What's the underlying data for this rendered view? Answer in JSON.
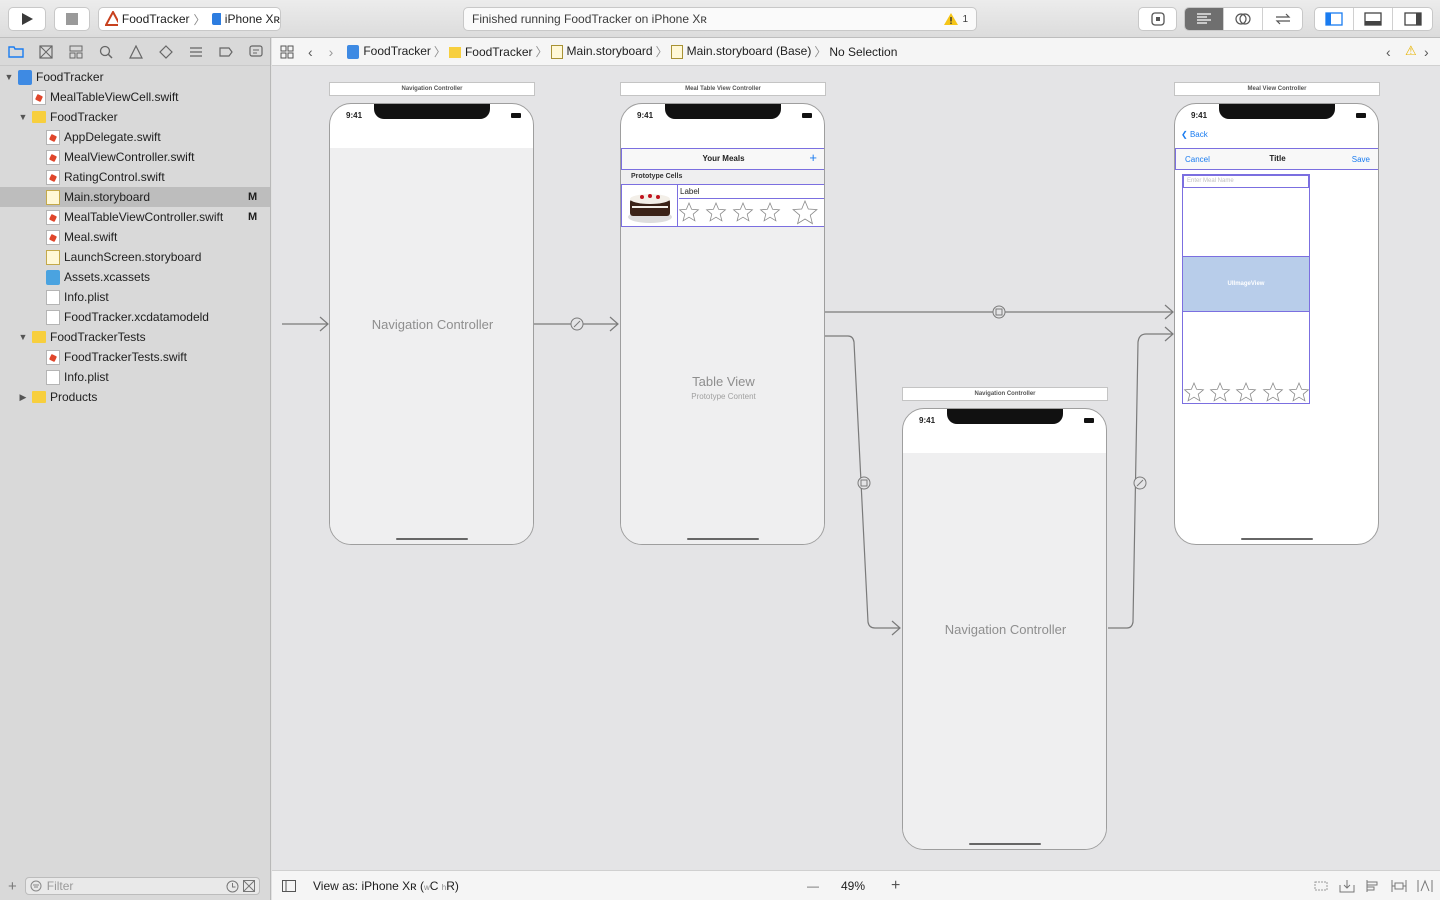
{
  "toolbar": {
    "scheme": {
      "project": "FoodTracker",
      "device": "iPhone Xʀ"
    },
    "activity": {
      "status": "Finished running FoodTracker on iPhone Xʀ",
      "warning_count": "1"
    }
  },
  "navigator": {
    "filter_placeholder": "Filter",
    "items": [
      {
        "label": "FoodTracker",
        "kind": "project",
        "indent": 0,
        "disclosure": "open"
      },
      {
        "label": "MealTableViewCell.swift",
        "kind": "swift",
        "indent": 1
      },
      {
        "label": "FoodTracker",
        "kind": "folder",
        "indent": 1,
        "disclosure": "open"
      },
      {
        "label": "AppDelegate.swift",
        "kind": "swift",
        "indent": 2
      },
      {
        "label": "MealViewController.swift",
        "kind": "swift",
        "indent": 2
      },
      {
        "label": "RatingControl.swift",
        "kind": "swift",
        "indent": 2
      },
      {
        "label": "Main.storyboard",
        "kind": "storyboard",
        "indent": 2,
        "badge": "M",
        "selected": true
      },
      {
        "label": "MealTableViewController.swift",
        "kind": "swift",
        "indent": 2,
        "badge": "M"
      },
      {
        "label": "Meal.swift",
        "kind": "swift",
        "indent": 2
      },
      {
        "label": "LaunchScreen.storyboard",
        "kind": "storyboard",
        "indent": 2
      },
      {
        "label": "Assets.xcassets",
        "kind": "assets",
        "indent": 2
      },
      {
        "label": "Info.plist",
        "kind": "plist",
        "indent": 2
      },
      {
        "label": "FoodTracker.xcdatamodeld",
        "kind": "plist",
        "indent": 2
      },
      {
        "label": "FoodTrackerTests",
        "kind": "folder",
        "indent": 1,
        "disclosure": "open"
      },
      {
        "label": "FoodTrackerTests.swift",
        "kind": "swift",
        "indent": 2
      },
      {
        "label": "Info.plist",
        "kind": "plist",
        "indent": 2
      },
      {
        "label": "Products",
        "kind": "folder",
        "indent": 1,
        "disclosure": "closed"
      }
    ]
  },
  "jumpbar": {
    "crumbs": [
      "FoodTracker",
      "FoodTracker",
      "Main.storyboard",
      "Main.storyboard (Base)",
      "No Selection"
    ],
    "warning": "⚠"
  },
  "canvas": {
    "scene1": {
      "title": "Navigation Controller",
      "time": "9:41",
      "label": "Navigation Controller"
    },
    "scene2": {
      "title": "Meal Table View Controller",
      "time": "9:41",
      "nav_title": "Your Meals",
      "add": "+",
      "section": "Prototype Cells",
      "cell_label": "Label",
      "table_title": "Table View",
      "table_sub": "Prototype Content"
    },
    "scene3": {
      "title": "Navigation Controller",
      "time": "9:41",
      "label": "Navigation Controller"
    },
    "scene4": {
      "title": "Meal View Controller",
      "time": "9:41",
      "back": "Back",
      "cancel": "Cancel",
      "nav_title": "Title",
      "save": "Save",
      "field_placeholder": "Enter Meal Name",
      "image_label": "UIImageView"
    }
  },
  "footer": {
    "view_as": "View as: iPhone Xʀ (",
    "w": "w",
    "c": "C",
    "h": "h",
    "r": "R)",
    "zoom": "49%",
    "minus": "—",
    "plus": "+"
  },
  "colors": {
    "accent": "#1a7cf0",
    "selection_outline": "#7b6fe0",
    "image_blue": "#b8cdea"
  }
}
